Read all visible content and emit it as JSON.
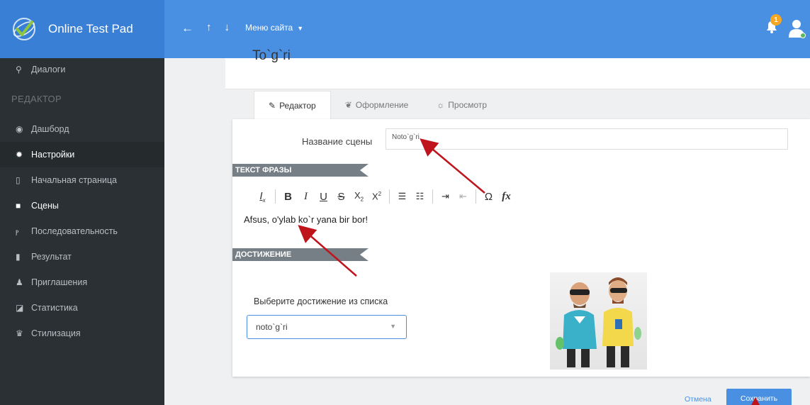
{
  "app": {
    "title": "Online Test Pad"
  },
  "navbar": {
    "site_menu": "Меню сайта",
    "notifications": "1"
  },
  "sidebar": {
    "top_item": "Диалоги",
    "section": "РЕДАКТОР",
    "items": [
      {
        "label": "Дашборд"
      },
      {
        "label": "Настройки"
      },
      {
        "label": "Начальная страница"
      },
      {
        "label": "Сцены"
      },
      {
        "label": "Последовательность"
      },
      {
        "label": "Результат"
      },
      {
        "label": "Приглашения"
      },
      {
        "label": "Статистика"
      },
      {
        "label": "Стилизация"
      }
    ]
  },
  "scene": {
    "title": "To`g`ri"
  },
  "tabs": [
    {
      "label": "Редактор"
    },
    {
      "label": "Оформление"
    },
    {
      "label": "Просмотр"
    }
  ],
  "form": {
    "name_label": "Название сцены",
    "name_value": "Noto`g`ri",
    "phrase_section": "ТЕКСТ ФРАЗЫ",
    "phrase_text": "Afsus, o'ylab ko`r yana bir bor!",
    "achievement_section": "ДОСТИЖЕНИЕ",
    "achievement_label": "Выберите достижение из списка",
    "achievement_value": "noto`g`ri"
  },
  "actions": {
    "cancel": "Отмена",
    "save": "Сохранить"
  },
  "colors": {
    "brand": "#3a7fd6",
    "navbar": "#4a90e2",
    "sidebar": "#2b3034",
    "annotation": "#c0141c"
  }
}
